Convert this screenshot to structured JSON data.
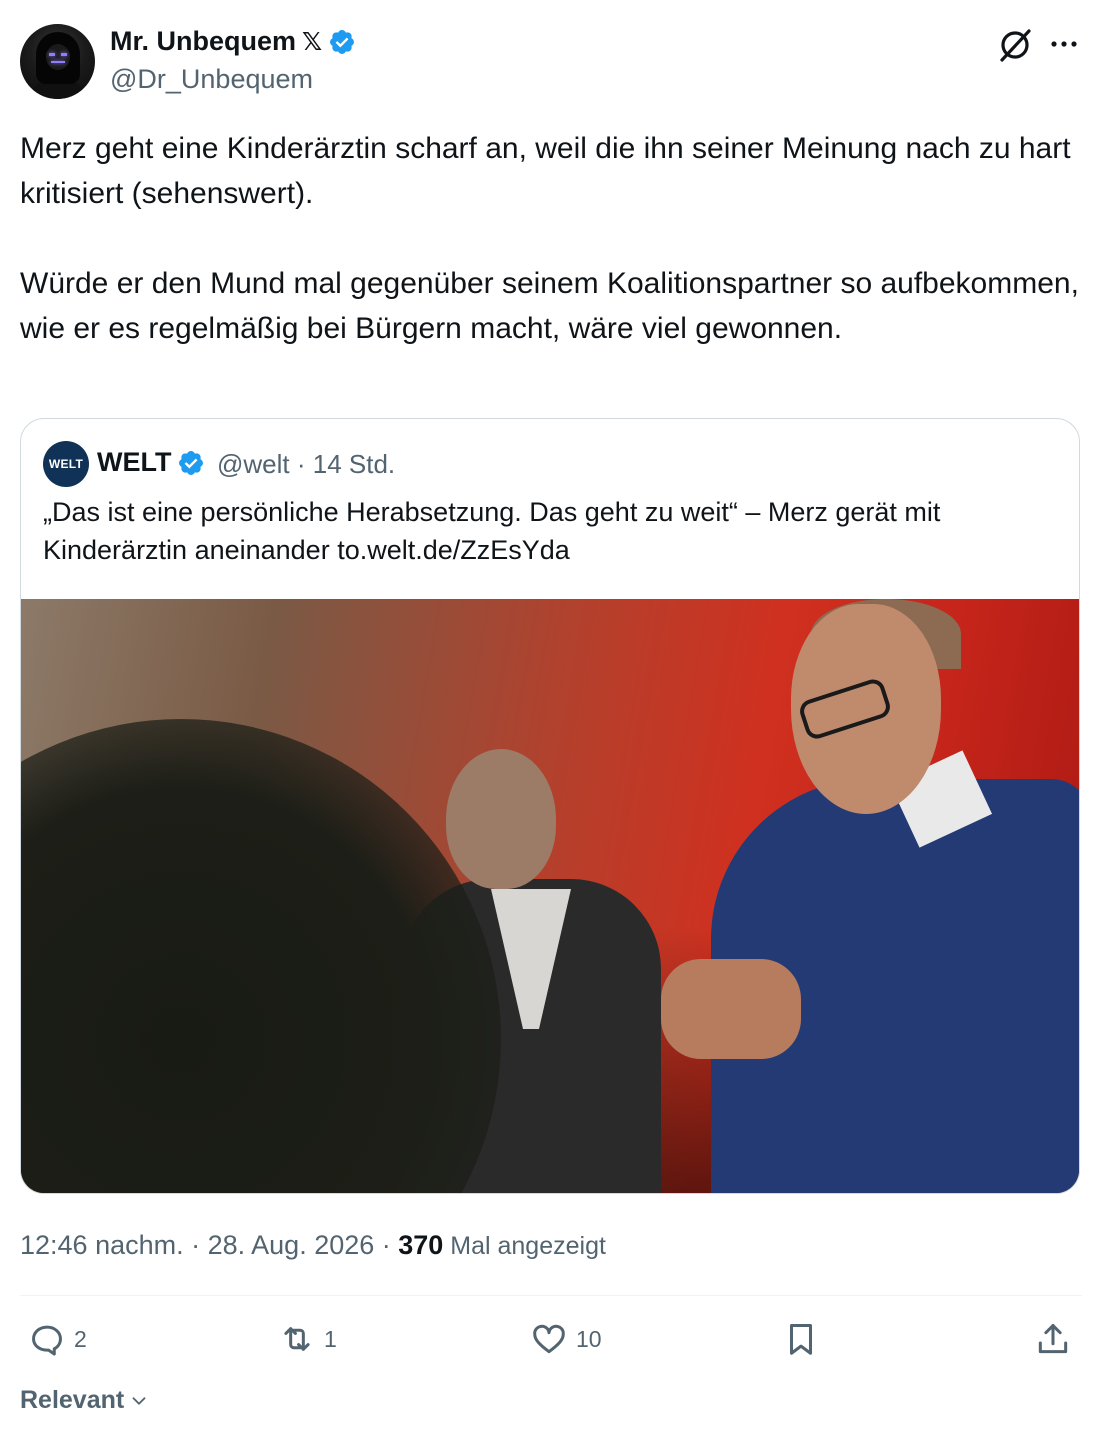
{
  "author": {
    "display_name": "Mr. Unbequem",
    "name_suffix": "𝕏",
    "handle": "@Dr_Unbequem",
    "verified": true,
    "verified_color": "#1d9bf0"
  },
  "header_icons": [
    "grok-icon",
    "more-icon"
  ],
  "tweet": {
    "paragraph_1": "Merz geht eine Kinderärztin scharf an, weil die ihn seiner Meinung nach zu hart kritisiert (sehenswert).",
    "paragraph_2": "Würde er den Mund mal gegenüber seinem Koalitionspartner so aufbekommen, wie er es regelmäßig bei Bürgern macht, wäre viel gewonnen."
  },
  "quote": {
    "avatar_text": "WELT",
    "name": "WELT",
    "verified": true,
    "meta": "@welt · 14 Std.",
    "text": "„Das ist eine persönliche Herabsetzung. Das geht zu weit“ – Merz gerät mit Kinderärztin aneinander to.welt.de/ZzEsYda"
  },
  "timestamp": {
    "time_date": "12:46 nachm. · 28. Aug. 2026 · ",
    "views_count": "370",
    "views_label": " Mal angezeigt"
  },
  "actions": {
    "reply_count": "2",
    "retweet_count": "1",
    "like_count": "10"
  },
  "sort": {
    "label": "Relevant"
  }
}
